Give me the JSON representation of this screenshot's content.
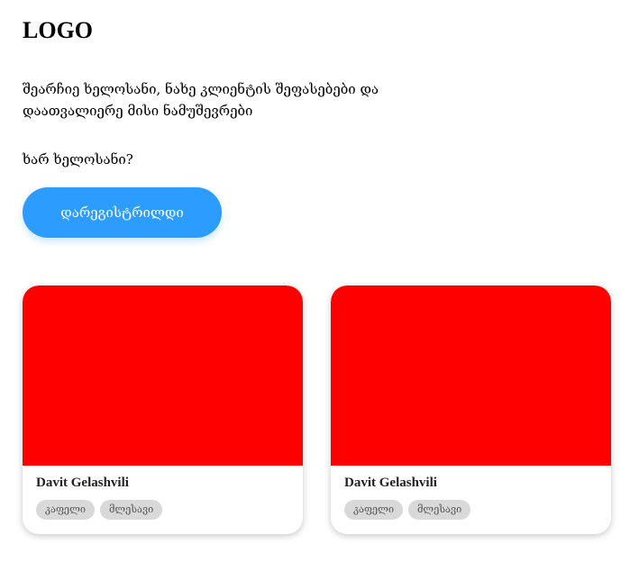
{
  "header": {
    "logo": "LOGO"
  },
  "hero": {
    "tagline": "შეარჩიე ხელოსანი, ნახე კლიენტის შეფასებები და დაათვალიერე მისი ნამუშევრები",
    "question": "ხარ ხელოსანი?",
    "register_label": "დარეგისტრილდი"
  },
  "colors": {
    "accent": "#2d9cff",
    "card_image": "#ff0000",
    "tag_background": "#d9d9d9"
  },
  "cards": [
    {
      "name": "Davit Gelashvili",
      "tags": [
        "კაფელი",
        "მლესავი"
      ]
    },
    {
      "name": "Davit Gelashvili",
      "tags": [
        "კაფელი",
        "მლესავი"
      ]
    }
  ]
}
